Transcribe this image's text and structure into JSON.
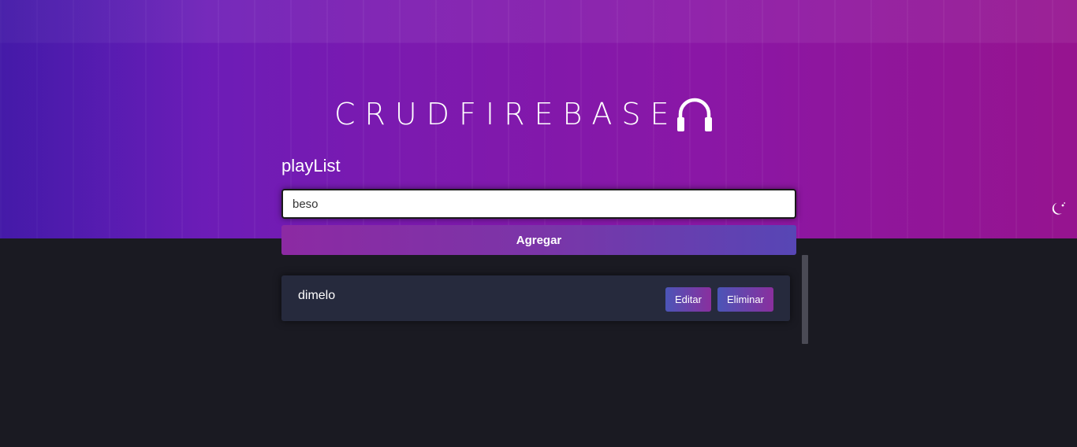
{
  "header": {
    "brand": "CRUDFIREBASE",
    "brand_icon": "headphones-icon",
    "section_title": "playList"
  },
  "form": {
    "input_value": "beso",
    "add_label": "Agregar"
  },
  "playlist": {
    "items": [
      {
        "name": "dimelo",
        "edit_label": "Editar",
        "delete_label": "Eliminar"
      }
    ]
  },
  "theme_toggle": {
    "icon": "moon-icon"
  },
  "colors": {
    "hero_start": "#5c1fbf",
    "hero_end": "#96148f",
    "page_background": "#1a1a22",
    "card_background": "#262a3d",
    "button_gradient_start": "#4b55b7",
    "button_gradient_end": "#8a2f9e"
  }
}
